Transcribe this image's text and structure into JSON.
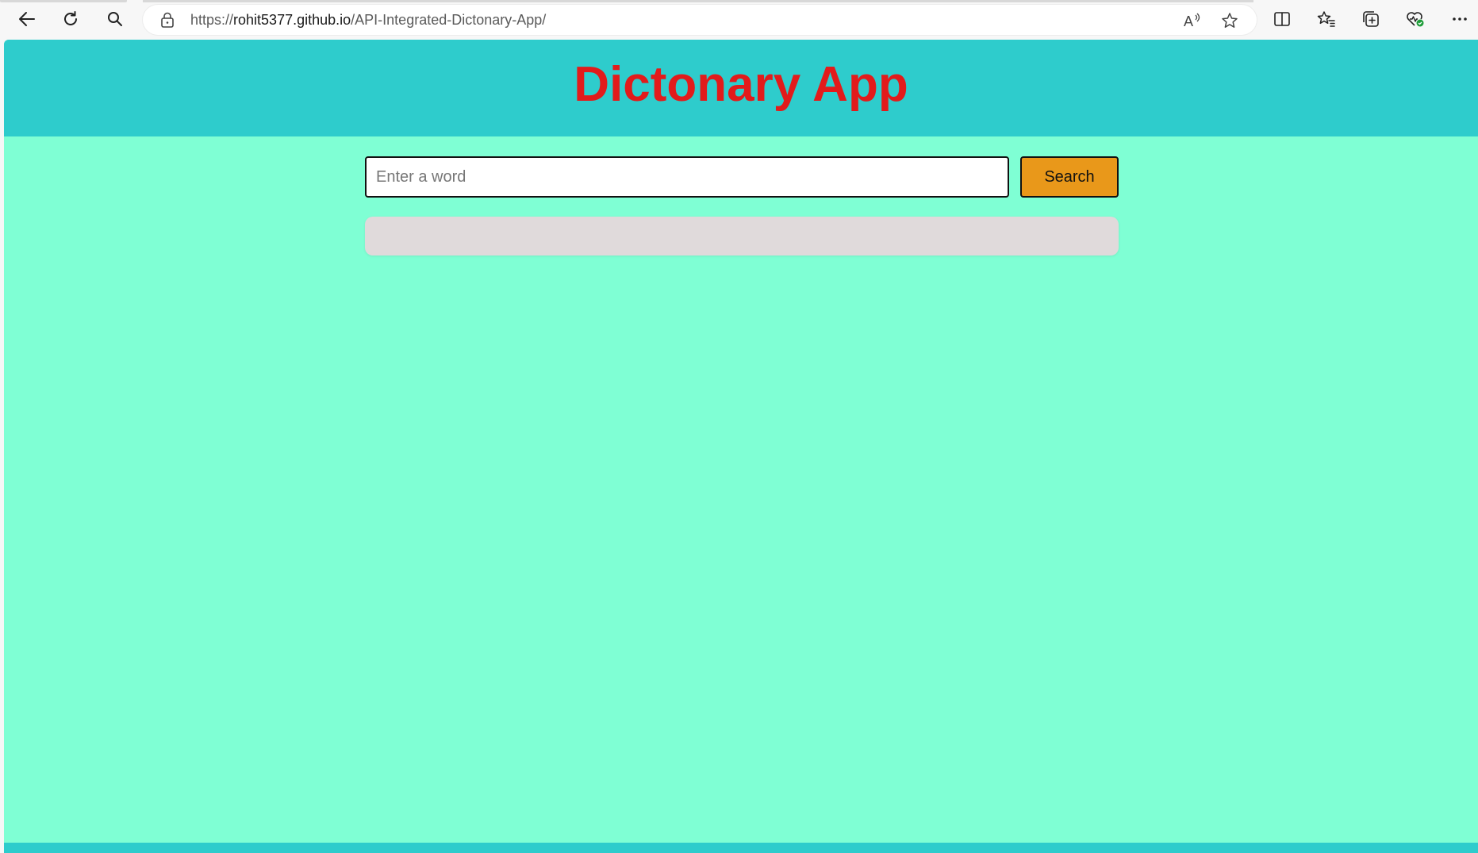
{
  "browser": {
    "url_prefix": "https://",
    "url_host": "rohit5377.github.io",
    "url_path": "/API-Integrated-Dictonary-App/",
    "toolbar_icons": [
      "back-arrow-icon",
      "refresh-icon",
      "search-icon",
      "lock-icon",
      "read-aloud-icon",
      "favorite-star-icon",
      "split-screen-icon",
      "favorites-icon",
      "collections-icon",
      "browser-essentials-icon",
      "more-options-icon"
    ]
  },
  "app": {
    "title": "Dictonary App",
    "search": {
      "placeholder": "Enter a word",
      "value": "",
      "button_label": "Search"
    },
    "result": ""
  },
  "colors": {
    "header_bg": "#2ecccc",
    "page_bg": "#7fffd4",
    "title": "#e21b1b",
    "button_bg": "#e9981a",
    "result_bg": "#e0dadb"
  }
}
